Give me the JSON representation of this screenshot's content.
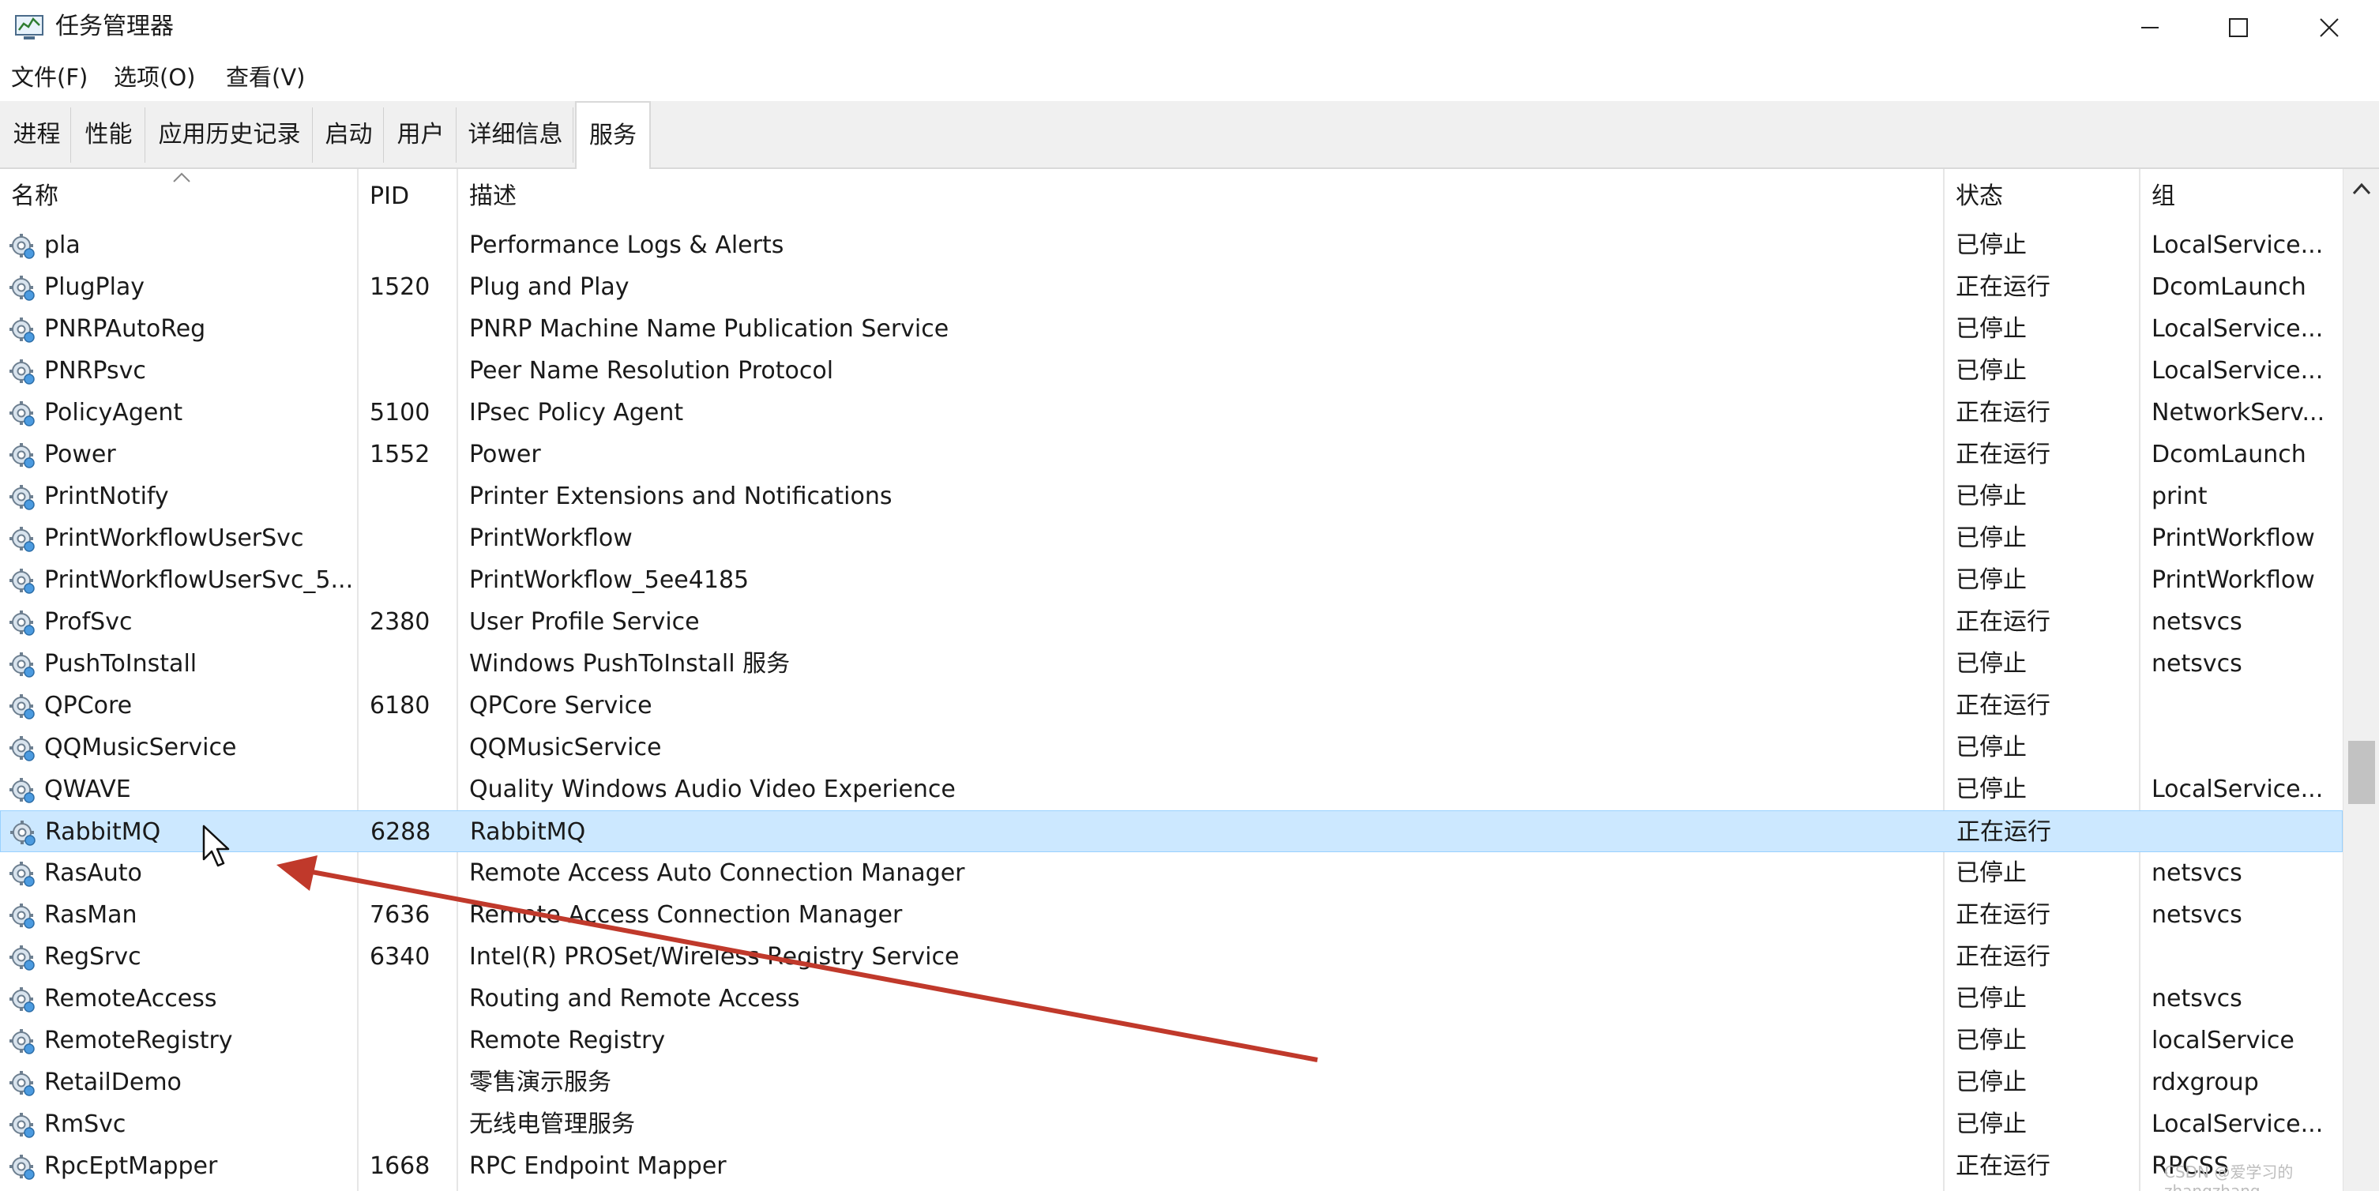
{
  "window": {
    "title": "任务管理器",
    "icon": "task-manager-icon",
    "controls": [
      "minimize-icon",
      "maximize-icon",
      "close-icon"
    ]
  },
  "menu": {
    "items": [
      {
        "label": "文件(F)"
      },
      {
        "label": "选项(O)"
      },
      {
        "label": "查看(V)"
      }
    ]
  },
  "tabs": [
    {
      "label": "进程",
      "active": false
    },
    {
      "label": "性能",
      "active": false
    },
    {
      "label": "应用历史记录",
      "active": false
    },
    {
      "label": "启动",
      "active": false
    },
    {
      "label": "用户",
      "active": false
    },
    {
      "label": "详细信息",
      "active": false
    },
    {
      "label": "服务",
      "active": true
    }
  ],
  "table": {
    "columns": {
      "name": "名称",
      "pid": "PID",
      "description": "描述",
      "status": "状态",
      "group": "组"
    },
    "sorted_by": "名称",
    "selected_row": "RabbitMQ",
    "rows": [
      {
        "name": "pla",
        "pid": "",
        "description": "Performance Logs & Alerts",
        "status": "已停止",
        "group": "LocalService..."
      },
      {
        "name": "PlugPlay",
        "pid": "1520",
        "description": "Plug and Play",
        "status": "正在运行",
        "group": "DcomLaunch"
      },
      {
        "name": "PNRPAutoReg",
        "pid": "",
        "description": "PNRP Machine Name Publication Service",
        "status": "已停止",
        "group": "LocalService..."
      },
      {
        "name": "PNRPsvc",
        "pid": "",
        "description": "Peer Name Resolution Protocol",
        "status": "已停止",
        "group": "LocalService..."
      },
      {
        "name": "PolicyAgent",
        "pid": "5100",
        "description": "IPsec Policy Agent",
        "status": "正在运行",
        "group": "NetworkServ..."
      },
      {
        "name": "Power",
        "pid": "1552",
        "description": "Power",
        "status": "正在运行",
        "group": "DcomLaunch"
      },
      {
        "name": "PrintNotify",
        "pid": "",
        "description": "Printer Extensions and Notifications",
        "status": "已停止",
        "group": "print"
      },
      {
        "name": "PrintWorkflowUserSvc",
        "pid": "",
        "description": "PrintWorkflow",
        "status": "已停止",
        "group": "PrintWorkflow"
      },
      {
        "name": "PrintWorkflowUserSvc_5...",
        "pid": "",
        "description": "PrintWorkflow_5ee4185",
        "status": "已停止",
        "group": "PrintWorkflow"
      },
      {
        "name": "ProfSvc",
        "pid": "2380",
        "description": "User Profile Service",
        "status": "正在运行",
        "group": "netsvcs"
      },
      {
        "name": "PushToInstall",
        "pid": "",
        "description": "Windows PushToInstall 服务",
        "status": "已停止",
        "group": "netsvcs"
      },
      {
        "name": "QPCore",
        "pid": "6180",
        "description": "QPCore Service",
        "status": "正在运行",
        "group": ""
      },
      {
        "name": "QQMusicService",
        "pid": "",
        "description": "QQMusicService",
        "status": "已停止",
        "group": ""
      },
      {
        "name": "QWAVE",
        "pid": "",
        "description": "Quality Windows Audio Video Experience",
        "status": "已停止",
        "group": "LocalService..."
      },
      {
        "name": "RabbitMQ",
        "pid": "6288",
        "description": "RabbitMQ",
        "status": "正在运行",
        "group": ""
      },
      {
        "name": "RasAuto",
        "pid": "",
        "description": "Remote Access Auto Connection Manager",
        "status": "已停止",
        "group": "netsvcs"
      },
      {
        "name": "RasMan",
        "pid": "7636",
        "description": "Remote Access Connection Manager",
        "status": "正在运行",
        "group": "netsvcs"
      },
      {
        "name": "RegSrvc",
        "pid": "6340",
        "description": "Intel(R) PROSet/Wireless Registry Service",
        "status": "正在运行",
        "group": ""
      },
      {
        "name": "RemoteAccess",
        "pid": "",
        "description": "Routing and Remote Access",
        "status": "已停止",
        "group": "netsvcs"
      },
      {
        "name": "RemoteRegistry",
        "pid": "",
        "description": "Remote Registry",
        "status": "已停止",
        "group": "localService"
      },
      {
        "name": "RetailDemo",
        "pid": "",
        "description": "零售演示服务",
        "status": "已停止",
        "group": "rdxgroup"
      },
      {
        "name": "RmSvc",
        "pid": "",
        "description": "无线电管理服务",
        "status": "已停止",
        "group": "LocalService..."
      },
      {
        "name": "RpcEptMapper",
        "pid": "1668",
        "description": "RPC Endpoint Mapper",
        "status": "正在运行",
        "group": "RPCSS"
      }
    ]
  },
  "annotation": {
    "arrow_color": "#c0392b",
    "points_to": "RabbitMQ"
  },
  "watermark": "CSDN @爱学习的zhangzhang",
  "colors": {
    "selection": "#cce8ff",
    "selection_border": "#99d1ff",
    "tabbar": "#f0f0f0"
  }
}
